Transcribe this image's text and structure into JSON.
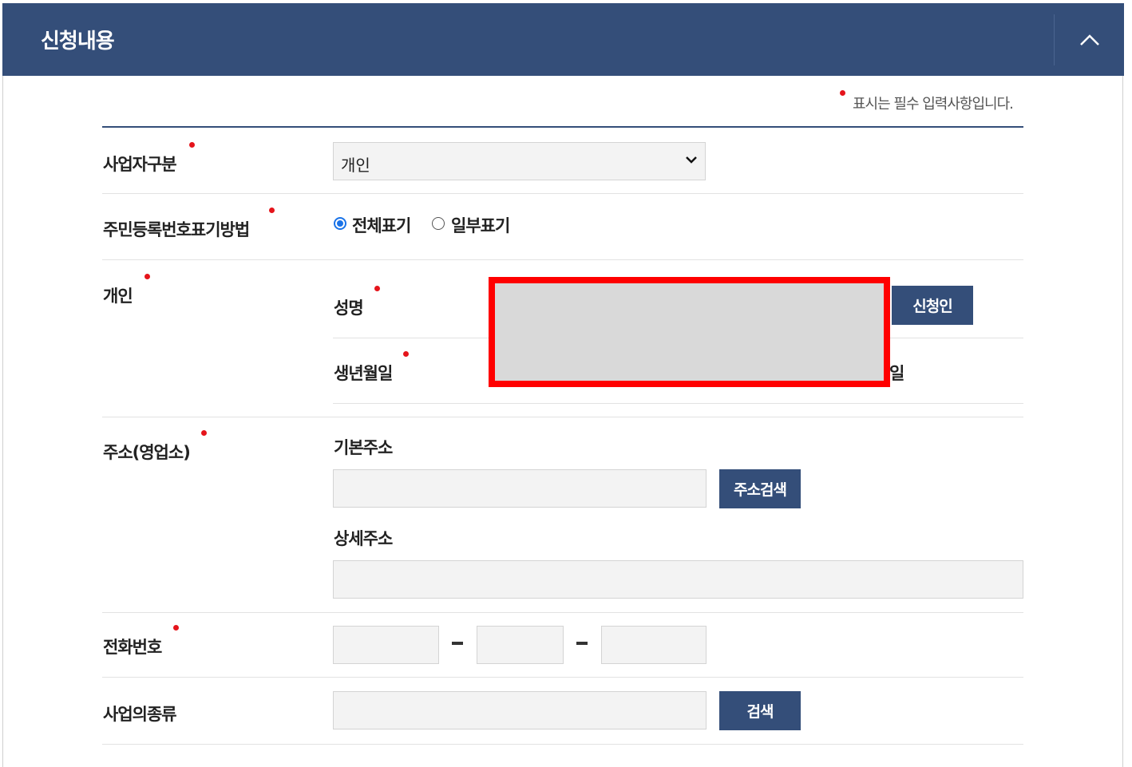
{
  "header": {
    "title": "신청내용",
    "collapse_icon": "chevron-up-icon"
  },
  "required_note": "표시는 필수 입력사항입니다.",
  "form": {
    "business_type": {
      "label": "사업자구분",
      "selected": "개인"
    },
    "ssn_display": {
      "label": "주민등록번호표기방법",
      "options": [
        {
          "label": "전체표기",
          "checked": true
        },
        {
          "label": "일부표기",
          "checked": false
        }
      ]
    },
    "individual": {
      "label": "개인",
      "name_label": "성명",
      "applicant_button": "신청인",
      "birth_label": "생년월일",
      "day_suffix": "일"
    },
    "address": {
      "label": "주소(영업소)",
      "basic_label": "기본주소",
      "search_button": "주소검색",
      "detail_label": "상세주소"
    },
    "phone": {
      "label": "전화번호",
      "separator": "-"
    },
    "business_kind": {
      "label": "사업의종류",
      "search_button": "검색"
    }
  },
  "colors": {
    "brand": "#344e79",
    "required": "#e5141b",
    "redaction_border": "#ff0000"
  }
}
